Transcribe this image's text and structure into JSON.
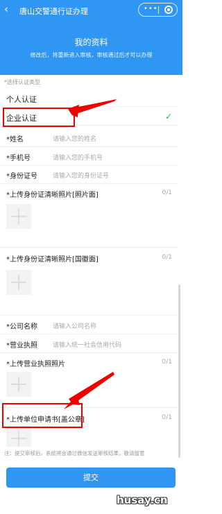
{
  "header_bar": {
    "back_glyph": "‹",
    "title": "唐山交警通行证办理",
    "more_glyph": "•••"
  },
  "banner": {
    "title": "我的资料",
    "subtitle": "修改后，将重新进入审核，审核通过后才可以办理"
  },
  "auth_type": {
    "label": "*选择认证类型",
    "options": [
      {
        "label": "个人认证",
        "selected": false
      },
      {
        "label": "企业认证",
        "selected": true
      }
    ],
    "check_glyph": "✓"
  },
  "fields": [
    {
      "label": "*姓名",
      "placeholder": "请输入您的姓名"
    },
    {
      "label": "*手机号",
      "placeholder": "请输入您的手机号"
    },
    {
      "label": "*身份证号",
      "placeholder": "请输入您的身份证号"
    }
  ],
  "uploads": [
    {
      "label": "*上传身份证清晰照片[照片面]",
      "count": "0/1"
    },
    {
      "label": "*上传身份证清晰照片[国徽面]",
      "count": "0/1"
    }
  ],
  "company_fields": [
    {
      "label": "*公司名称",
      "placeholder": "请输入公司名称"
    },
    {
      "label": "*营业执照",
      "placeholder": "请输入统一社会信用代码"
    }
  ],
  "company_uploads": [
    {
      "label": "*上传营业执照照片",
      "count": "0/1"
    },
    {
      "label": "*上传单位申请书[盖公章]",
      "count": "0/1"
    }
  ],
  "note": "注：提交审核后，系统将会通过微信发送审核结果，敬请留意",
  "submit_label": "提交",
  "watermark": "husay.cn",
  "colors": {
    "primary": "#2f96f3",
    "check": "#2ab44b",
    "annotation": "#e00000"
  }
}
